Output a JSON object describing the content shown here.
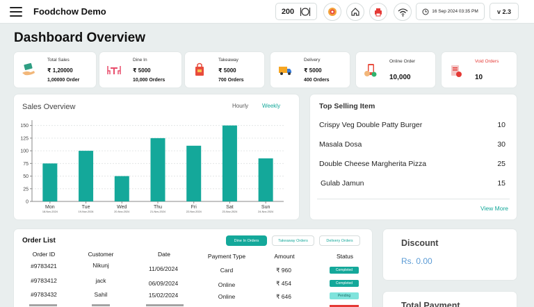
{
  "header": {
    "app_title": "Foodchow Demo",
    "counter": "200",
    "datetime": "16 Sep 2024 03:35 PM",
    "version": "v 2.3"
  },
  "page_title": "Dashboard Overview",
  "stats": [
    {
      "label": "Total Sales",
      "value": "₹ 1,20000",
      "sub": "1,00000 Order",
      "icon": "money-hand-icon"
    },
    {
      "label": "Dine In",
      "value": "₹ 5000",
      "sub": "10,000 Orders",
      "icon": "dine-in-table-icon"
    },
    {
      "label": "Takeaway",
      "value": "₹ 5000",
      "sub": "700 Orders",
      "icon": "takeaway-bag-icon"
    },
    {
      "label": "Delivery",
      "value": "₹ 5000",
      "sub": "400 Orders",
      "icon": "delivery-truck-icon"
    },
    {
      "label": "Online Order",
      "value": "10,000",
      "sub": "",
      "icon": "mobile-order-icon"
    },
    {
      "label": "Void Orders",
      "value": "10",
      "sub": "",
      "icon": "void-order-icon"
    }
  ],
  "sales_overview": {
    "title": "Sales Overview",
    "tabs": [
      "Hourly",
      "Weekly"
    ],
    "active_tab": "Weekly"
  },
  "chart_data": {
    "type": "bar",
    "categories": [
      "Mon",
      "Tue",
      "Wed",
      "Thu",
      "Fri",
      "Sat",
      "Sun"
    ],
    "dates": [
      "18-Nov-2024",
      "19-Nov-2024",
      "20-Nov-2024",
      "21-Nov-2024",
      "22-Nov-2024",
      "23-Nov-2024",
      "24-Nov-2024"
    ],
    "values": [
      75,
      100,
      50,
      125,
      110,
      150,
      85
    ],
    "yticks": [
      0,
      25,
      50,
      75,
      100,
      125,
      150
    ],
    "ylim": [
      0,
      155
    ],
    "grid": true,
    "color": "#14a89a"
  },
  "top_selling": {
    "title": "Top Selling Item",
    "items": [
      {
        "name": "Crispy Veg Double Patty Burger",
        "qty": "10"
      },
      {
        "name": "Masala Dosa",
        "qty": "30"
      },
      {
        "name": "Double Cheese Margherita Pizza",
        "qty": "25"
      },
      {
        "name": "Gulab Jamun",
        "qty": "15"
      }
    ],
    "view_more": "View More"
  },
  "order_list": {
    "title": "Order List",
    "filters": [
      "Dine In Orders",
      "Takeaway Orders",
      "Delivery Orders"
    ],
    "columns": [
      "Order ID",
      "Customer",
      "Date",
      "Payment Type",
      "Amount",
      "Status"
    ],
    "rows": [
      {
        "id": "#9783421",
        "customer": "Nikunj",
        "date": "11/06/2024",
        "payment": "Card",
        "amount": "₹ 960",
        "status": "Completed"
      },
      {
        "id": "#9783412",
        "customer": "jack",
        "date": "06/09/2024",
        "payment": "Online",
        "amount": "₹ 454",
        "status": "Completed"
      },
      {
        "id": "#9783432",
        "customer": "Sahil",
        "date": "15/02/2024",
        "payment": "Online",
        "amount": "₹ 646",
        "status": "Pending"
      }
    ]
  },
  "discount": {
    "title": "Discount",
    "value": "Rs. 0.00"
  },
  "total_payment": {
    "title": "Total Payment"
  },
  "colors": {
    "accent": "#14a89a",
    "void": "#e53935",
    "pending": "#7fe3dc",
    "completed": "#14a89a",
    "link": "#5b9bd5"
  }
}
